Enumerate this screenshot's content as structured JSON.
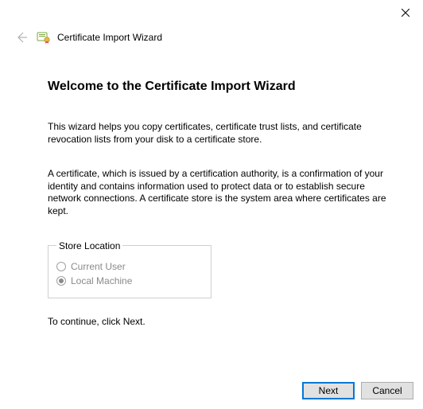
{
  "window": {
    "title": "Certificate Import Wizard"
  },
  "content": {
    "heading": "Welcome to the Certificate Import Wizard",
    "intro": "This wizard helps you copy certificates, certificate trust lists, and certificate revocation lists from your disk to a certificate store.",
    "description": "A certificate, which is issued by a certification authority, is a confirmation of your identity and contains information used to protect data or to establish secure network connections. A certificate store is the system area where certificates are kept.",
    "store_location": {
      "legend": "Store Location",
      "options": {
        "current_user": "Current User",
        "local_machine": "Local Machine"
      },
      "selected": "local_machine"
    },
    "continue_hint": "To continue, click Next."
  },
  "buttons": {
    "next": "Next",
    "cancel": "Cancel"
  }
}
